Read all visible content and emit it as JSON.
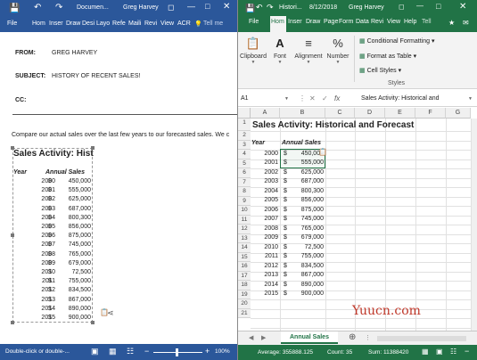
{
  "word": {
    "title": "Documen...",
    "user": "Greg Harvey",
    "tabs": [
      "File",
      "Hom",
      "Inser",
      "Draw",
      "Desi",
      "Layo",
      "Refe",
      "Maili",
      "Revi",
      "View",
      "ACR",
      "Tell me"
    ],
    "email": {
      "from_label": "FROM:",
      "from_value": "GREG HARVEY",
      "subject_label": "SUBJECT:",
      "subject_value": "HISTORY OF RECENT SALES!",
      "cc_label": "CC:"
    },
    "body_text": "Compare our actual sales over the last few years to our forecasted sales. We c",
    "embed": {
      "title": "Sales Activity: Hist",
      "year_header": "Year",
      "sales_header": "Annual Sales",
      "rows": [
        {
          "year": "2000",
          "dollar": "$",
          "amt": "450,000"
        },
        {
          "year": "2001",
          "dollar": "$",
          "amt": "555,000"
        },
        {
          "year": "2002",
          "dollar": "$",
          "amt": "625,000"
        },
        {
          "year": "2003",
          "dollar": "$",
          "amt": "687,000"
        },
        {
          "year": "2004",
          "dollar": "$",
          "amt": "800,300"
        },
        {
          "year": "2005",
          "dollar": "$",
          "amt": "856,000"
        },
        {
          "year": "2006",
          "dollar": "$",
          "amt": "875,000"
        },
        {
          "year": "2007",
          "dollar": "$",
          "amt": "745,000"
        },
        {
          "year": "2008",
          "dollar": "$",
          "amt": "765,000"
        },
        {
          "year": "2009",
          "dollar": "$",
          "amt": "679,000"
        },
        {
          "year": "2010",
          "dollar": "$",
          "amt": "72,500"
        },
        {
          "year": "2011",
          "dollar": "$",
          "amt": "755,000"
        },
        {
          "year": "2012",
          "dollar": "$",
          "amt": "834,500"
        },
        {
          "year": "2013",
          "dollar": "$",
          "amt": "867,000"
        },
        {
          "year": "2014",
          "dollar": "$",
          "amt": "890,000"
        },
        {
          "year": "2015",
          "dollar": "$",
          "amt": "900,000"
        }
      ]
    },
    "status_text": "Double-click or double-...",
    "zoom": "100%"
  },
  "excel": {
    "title": "Histori...",
    "date": "8/12/2018",
    "user": "Greg Harvey",
    "tabs": [
      "File",
      "Hom",
      "Inser",
      "Draw",
      "Page",
      "Form",
      "Data",
      "Revi",
      "View",
      "Help",
      "Tell"
    ],
    "ribbon": {
      "clipboard": "Clipboard",
      "font": "Font",
      "alignment": "Alignment",
      "number": "Number",
      "cond_fmt": "Conditional Formatting",
      "fmt_table": "Format as Table",
      "cell_styles": "Cell Styles",
      "styles": "Styles"
    },
    "name_box": "A1",
    "formula": "Sales Activity: Historical and",
    "columns": [
      "A",
      "B",
      "C",
      "D",
      "E",
      "F",
      "G"
    ],
    "sheet_title": "Sales Activity: Historical and Forecast",
    "year_header": "Year",
    "sales_header": "Annual Sales",
    "row_numbers": [
      "1",
      "2",
      "3",
      "4",
      "5",
      "6",
      "7",
      "8",
      "9",
      "10",
      "11",
      "12",
      "13",
      "14",
      "15",
      "16",
      "17",
      "18",
      "19",
      "20",
      "21"
    ],
    "sheet_tab": "Annual Sales",
    "status": {
      "average": "Average: 355888.125",
      "count": "Count: 35",
      "sum": "Sum: 11388420"
    }
  },
  "watermark": "Yuucn.com",
  "colors": {
    "word_blue": "#2b579a",
    "excel_green": "#217346"
  }
}
